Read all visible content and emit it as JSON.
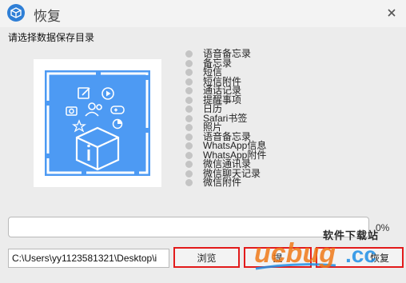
{
  "window": {
    "title": "恢复",
    "prompt": "请选择数据保存目录"
  },
  "backup_types": [
    "语音备忘录",
    "备忘录",
    "短信",
    "短信附件",
    "通话记录",
    "提醒事项",
    "日历",
    "Safari书签",
    "照片",
    "语音备忘录",
    "WhatsApp信息",
    "WhatsApp附件",
    "微信通讯录",
    "微信聊天记录",
    "微信附件"
  ],
  "progress": {
    "value": 0,
    "label": "0%"
  },
  "path": {
    "value": "C:\\Users\\yy1123581321\\Desktop\\i"
  },
  "buttons": {
    "browse": "浏览",
    "middle": "提",
    "restore": "恢复"
  },
  "watermark": {
    "brand": "ucbug",
    "suffix": ".cc",
    "site_name": "软件下载站"
  },
  "colors": {
    "accent": "#4d9af3",
    "highlight_border": "#e21b1b",
    "watermark_orange": "#f07a18",
    "watermark_blue": "#1f8fe6"
  },
  "icons": {
    "app": "box-icon",
    "close": "close-icon",
    "illustration": [
      "edit-icon",
      "play-icon",
      "camera-icon",
      "contacts-icon",
      "gamepad-icon",
      "star-icon",
      "pie-icon",
      "box-icon"
    ]
  }
}
